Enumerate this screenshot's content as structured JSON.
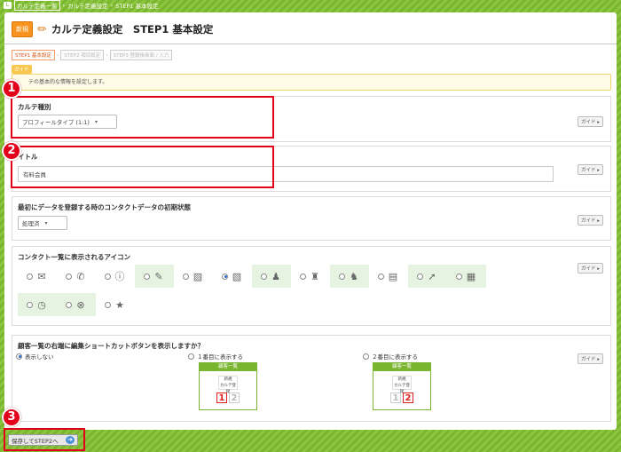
{
  "breadcrumb": {
    "home_icon": "L",
    "items": [
      "カルテ定義一覧",
      "カルテ定義設定",
      "STEP1 基本設定"
    ]
  },
  "header": {
    "badge": "新規",
    "title": "カルテ定義設定　STEP1 基本設定"
  },
  "steps": [
    "STEP1 基本設定",
    "STEP2 項目設定",
    "STEP3 登録後画面 / 入力"
  ],
  "guide": {
    "tag": "ガイド",
    "text": "テの基本的な情報を設定します。"
  },
  "guide_button_label": "ガイド ▸",
  "sections": {
    "type": {
      "label": "カルテ種別",
      "selected": "プロフィールタイプ (1:1)"
    },
    "title": {
      "label": "イトル",
      "value": "有料会員"
    },
    "initial_state": {
      "label": "最初にデータを登録する時のコンタクトデータの初期状態",
      "selected": "処理済"
    },
    "icons": {
      "label": "コンタクト一覧に表示されるアイコン",
      "items": [
        {
          "icon": "envelope-icon",
          "glyph": "✉",
          "selected": false
        },
        {
          "icon": "phone-icon",
          "glyph": "✆",
          "selected": false
        },
        {
          "icon": "exclamation-icon",
          "glyph": "ⓘ",
          "selected": false
        },
        {
          "icon": "pencil-icon",
          "glyph": "✎",
          "selected": false
        },
        {
          "icon": "image-icon",
          "glyph": "▨",
          "selected": false
        },
        {
          "icon": "note-icon",
          "glyph": "▧",
          "selected": true
        },
        {
          "icon": "person-icon",
          "glyph": "♟",
          "selected": false
        },
        {
          "icon": "person-badge-icon",
          "glyph": "♜",
          "selected": false
        },
        {
          "icon": "people-icon",
          "glyph": "♞",
          "selected": false
        },
        {
          "icon": "documents-icon",
          "glyph": "▤",
          "selected": false
        },
        {
          "icon": "arrow-icon",
          "glyph": "➚",
          "selected": false
        },
        {
          "icon": "calendar-icon",
          "glyph": "▦",
          "selected": false
        },
        {
          "icon": "clock-icon",
          "glyph": "◷",
          "selected": false
        },
        {
          "icon": "cancel-icon",
          "glyph": "⊗",
          "selected": false
        },
        {
          "icon": "star-icon",
          "glyph": "★",
          "selected": false
        }
      ]
    },
    "shortcut": {
      "label": "顧客一覧の右端に編集ショートカットボタンを表示しますか？",
      "options": [
        "表示しない",
        "１番目に表示する",
        "２番目に表示する"
      ],
      "selected_index": 0,
      "preview_header": "顧客一覧",
      "preview_mini": "新規\nカルテ登録",
      "preview_nums": [
        "1",
        "2"
      ]
    }
  },
  "save_button": "保存してSTEP2へ",
  "markers": [
    "1",
    "2",
    "3"
  ],
  "colors": {
    "accent_green": "#8cc63f",
    "highlight_red": "#e3001b",
    "badge_orange": "#f7931e"
  }
}
